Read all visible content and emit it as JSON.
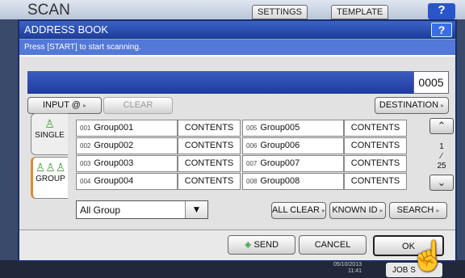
{
  "background": {
    "title": "SCAN",
    "tabs": [
      "SETTINGS",
      "TEMPLATE"
    ],
    "help": "?",
    "clock": [
      "05/10/2013",
      "11:41"
    ],
    "job_button": "JOB S"
  },
  "dialog": {
    "title": "ADDRESS BOOK",
    "help": "?",
    "message": "Press [START] to start scanning.",
    "count": "0005",
    "buttons": {
      "input_at": "INPUT @",
      "clear": "CLEAR",
      "destination": "DESTINATION",
      "all_clear": "ALL CLEAR",
      "known_id": "KNOWN ID",
      "search": "SEARCH",
      "send": "SEND",
      "cancel": "CANCEL",
      "ok": "OK"
    },
    "tabs": {
      "single": "SINGLE",
      "group": "GROUP"
    },
    "groups": [
      {
        "num": "001",
        "name": "Group001",
        "action": "CONTENTS"
      },
      {
        "num": "002",
        "name": "Group002",
        "action": "CONTENTS"
      },
      {
        "num": "003",
        "name": "Group003",
        "action": "CONTENTS"
      },
      {
        "num": "004",
        "name": "Group004",
        "action": "CONTENTS"
      },
      {
        "num": "005",
        "name": "Group005",
        "action": "CONTENTS"
      },
      {
        "num": "006",
        "name": "Group006",
        "action": "CONTENTS"
      },
      {
        "num": "007",
        "name": "Group007",
        "action": "CONTENTS"
      },
      {
        "num": "008",
        "name": "Group008",
        "action": "CONTENTS"
      }
    ],
    "pager": {
      "current": "1",
      "total": "25"
    },
    "filter": {
      "selected": "All Group"
    }
  }
}
